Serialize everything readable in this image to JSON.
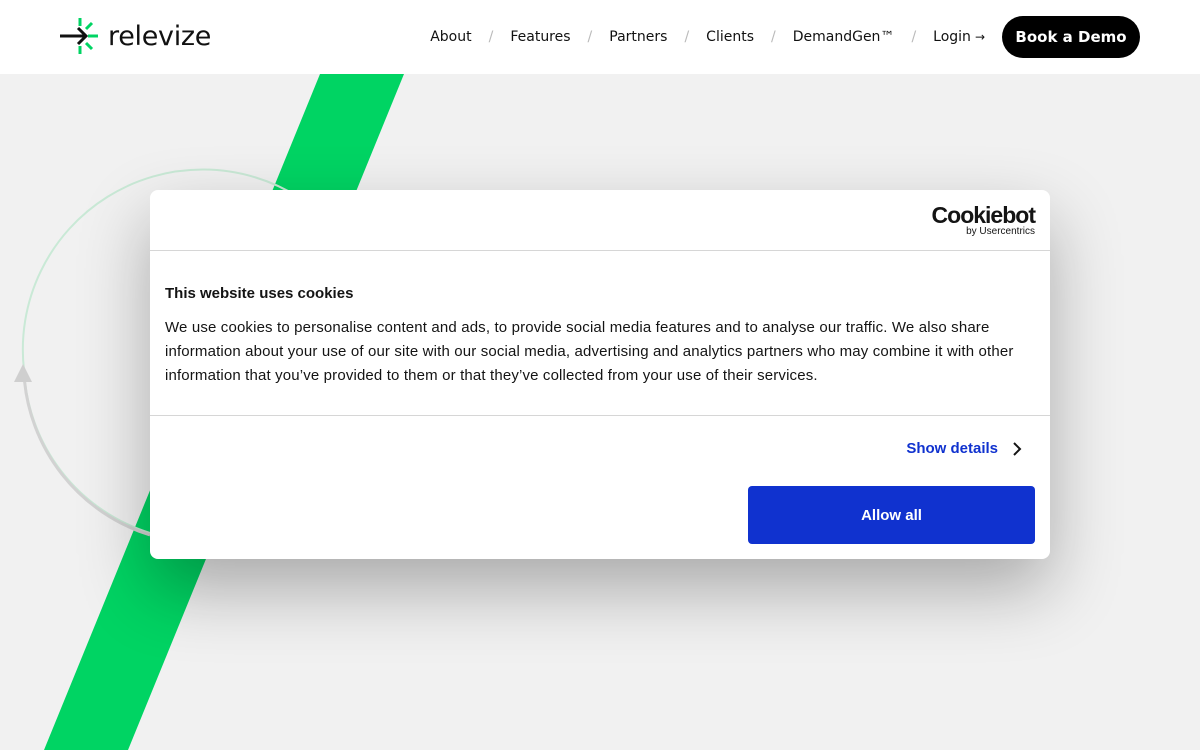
{
  "brand": {
    "name": "relevize",
    "accent": "#00d463"
  },
  "nav": {
    "items": [
      {
        "label": "About"
      },
      {
        "label": "Features"
      },
      {
        "label": "Partners"
      },
      {
        "label": "Clients"
      },
      {
        "label": "DemandGen™"
      }
    ],
    "separator": "/",
    "login_label": "Login",
    "login_arrow": "→",
    "cta_label": "Book a Demo"
  },
  "cookie_dialog": {
    "provider_name": "Cookiebot",
    "provider_sub": "by Usercentrics",
    "title": "This website uses cookies",
    "body": "We use cookies to personalise content and ads, to provide social media features and to analyse our traffic. We also share information about your use of our site with our social media, advertising and analytics partners who may combine it with other information that you’ve provided to them or that they’ve collected from your use of their services.",
    "details_label": "Show details",
    "allow_label": "Allow all",
    "button_color": "#1032cf"
  }
}
